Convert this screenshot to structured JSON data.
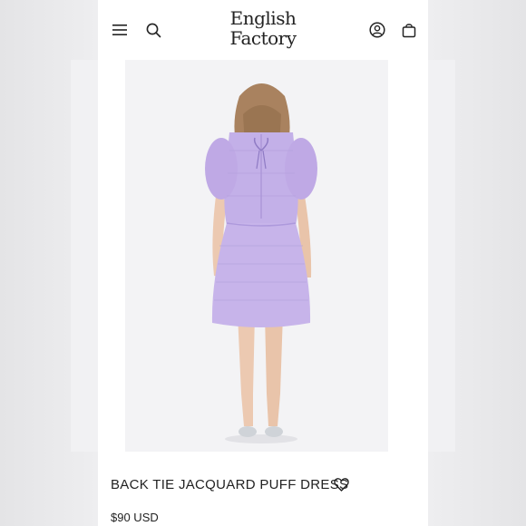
{
  "store": {
    "logo_line1": "English",
    "logo_line2": "Factory"
  },
  "header": {
    "icons": [
      "hamburger-menu-icon",
      "search-icon",
      "account-icon",
      "shopping-bag-icon"
    ]
  },
  "product": {
    "title": "BACK TIE JACQUARD PUFF DRESS",
    "price": "$90 USD",
    "image_alt": "Model wearing lavender puff sleeve dress, back view",
    "dress_color": "#c3b0e8",
    "wishlist_icon": "heart-outline-icon"
  },
  "colors": {
    "background": "#ffffff",
    "text": "#222222"
  }
}
